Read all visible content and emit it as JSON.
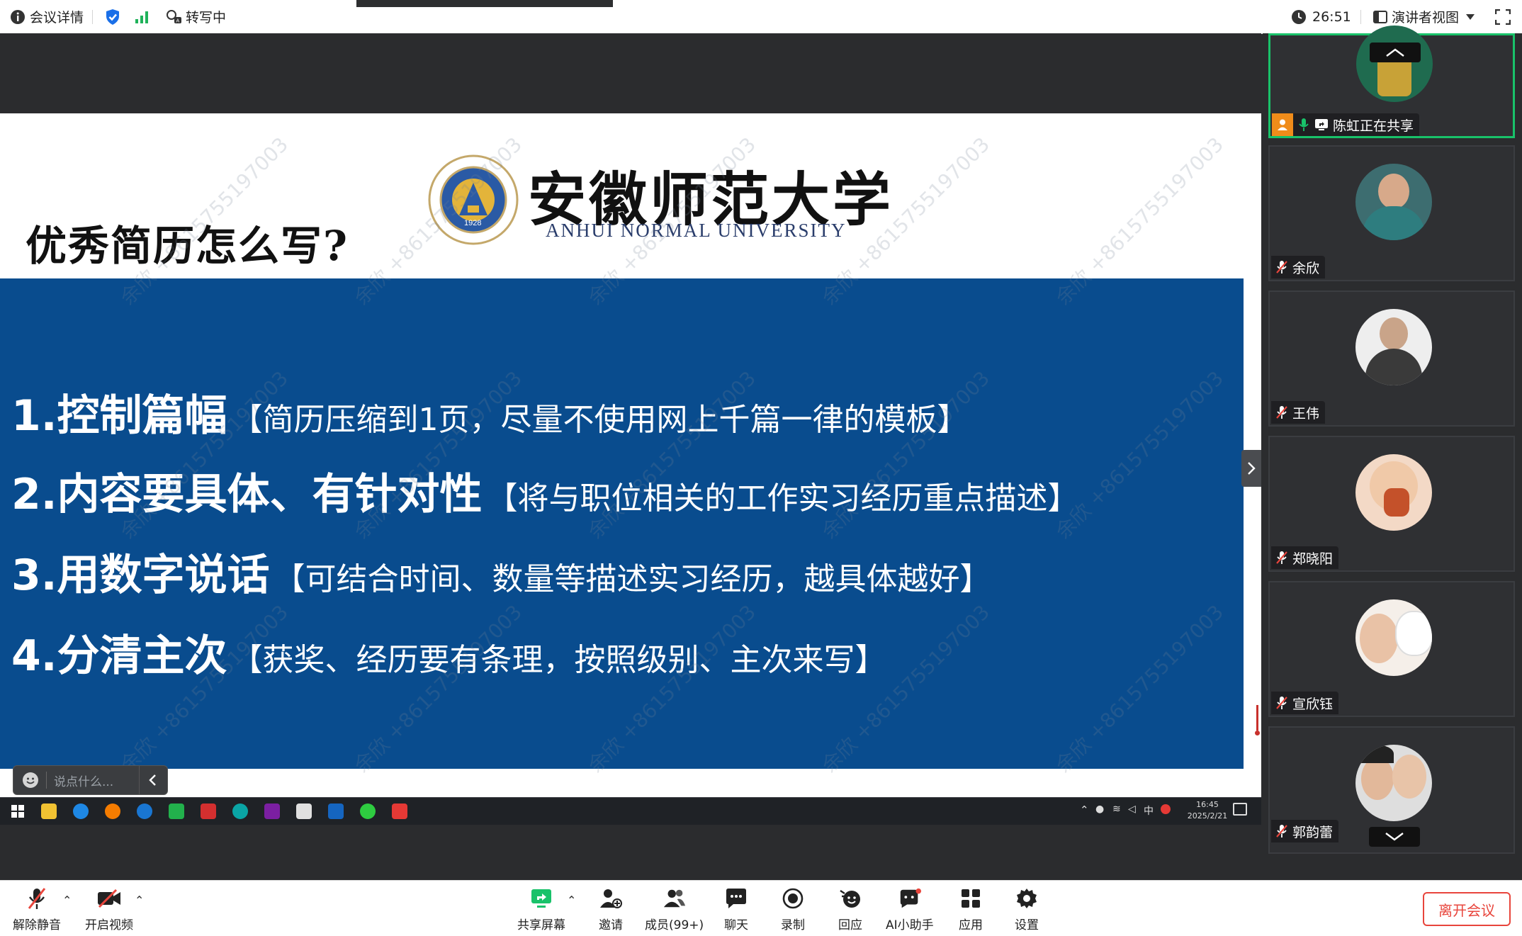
{
  "topbar": {
    "meeting_details": "会议详情",
    "transcribing": "转写中",
    "timer": "26:51",
    "view_mode": "演讲者视图"
  },
  "slide": {
    "title": "优秀简历怎么写?",
    "university_cn": "安徽师范大学",
    "university_en": "ANHUI NORMAL UNIVERSITY",
    "seal_year": "1928",
    "points": [
      {
        "head": "1.控制篇幅",
        "desc": "【简历压缩到1页，尽量不使用网上千篇一律的模板】"
      },
      {
        "head": "2.内容要具体、有针对性",
        "desc": "【将与职位相关的工作实习经历重点描述】"
      },
      {
        "head": "3.用数字说话",
        "desc": "【可结合时间、数量等描述实习经历，越具体越好】"
      },
      {
        "head": "4.分清主次",
        "desc": "【获奖、经历要有条理，按照级别、主次来写】"
      }
    ],
    "watermark": "余欣 +8615755197003"
  },
  "chat_input": {
    "placeholder": "说点什么..."
  },
  "taskbar": {
    "ime": "中",
    "time": "16:45",
    "date": "2025/2/21"
  },
  "participants": [
    {
      "name": "陈虹正在共享",
      "sharing": true
    },
    {
      "name": "余欣"
    },
    {
      "name": "王伟"
    },
    {
      "name": "郑晓阳"
    },
    {
      "name": "宣欣钰"
    },
    {
      "name": "郭韵蕾"
    }
  ],
  "bottombar": {
    "unmute": "解除静音",
    "start_video": "开启视频",
    "share_screen": "共享屏幕",
    "invite": "邀请",
    "members": "成员(99+)",
    "chat": "聊天",
    "record": "录制",
    "react": "回应",
    "ai_assistant": "AI小助手",
    "apps": "应用",
    "settings": "设置",
    "leave": "离开会议"
  },
  "colors": {
    "slide_blue": "#094c8e",
    "active_green": "#19c26a",
    "leave_red": "#e8453c",
    "accent_blue": "#1a6fe8"
  }
}
